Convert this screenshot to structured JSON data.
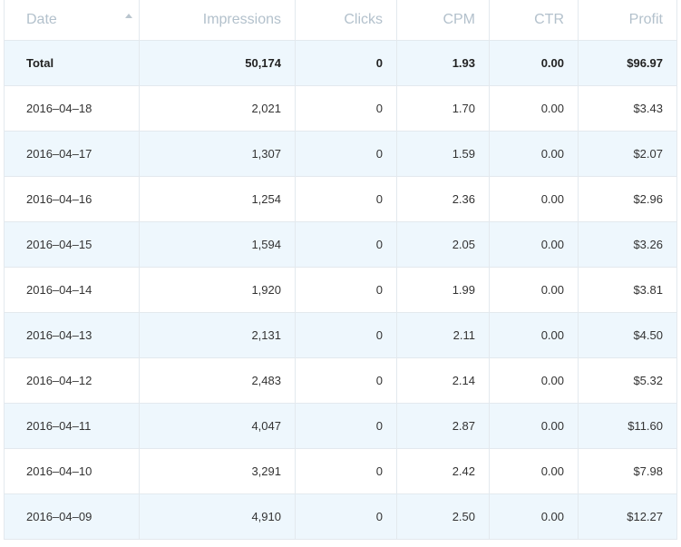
{
  "columns": {
    "date": "Date",
    "impressions": "Impressions",
    "clicks": "Clicks",
    "cpm": "CPM",
    "ctr": "CTR",
    "profit": "Profit"
  },
  "sort": {
    "column": "date",
    "icon": "sort-up-icon"
  },
  "total": {
    "label": "Total",
    "impressions": "50,174",
    "clicks": "0",
    "cpm": "1.93",
    "ctr": "0.00",
    "profit": "$96.97"
  },
  "rows": [
    {
      "date": "2016–04–18",
      "impressions": "2,021",
      "clicks": "0",
      "cpm": "1.70",
      "ctr": "0.00",
      "profit": "$3.43"
    },
    {
      "date": "2016–04–17",
      "impressions": "1,307",
      "clicks": "0",
      "cpm": "1.59",
      "ctr": "0.00",
      "profit": "$2.07"
    },
    {
      "date": "2016–04–16",
      "impressions": "1,254",
      "clicks": "0",
      "cpm": "2.36",
      "ctr": "0.00",
      "profit": "$2.96"
    },
    {
      "date": "2016–04–15",
      "impressions": "1,594",
      "clicks": "0",
      "cpm": "2.05",
      "ctr": "0.00",
      "profit": "$3.26"
    },
    {
      "date": "2016–04–14",
      "impressions": "1,920",
      "clicks": "0",
      "cpm": "1.99",
      "ctr": "0.00",
      "profit": "$3.81"
    },
    {
      "date": "2016–04–13",
      "impressions": "2,131",
      "clicks": "0",
      "cpm": "2.11",
      "ctr": "0.00",
      "profit": "$4.50"
    },
    {
      "date": "2016–04–12",
      "impressions": "2,483",
      "clicks": "0",
      "cpm": "2.14",
      "ctr": "0.00",
      "profit": "$5.32"
    },
    {
      "date": "2016–04–11",
      "impressions": "4,047",
      "clicks": "0",
      "cpm": "2.87",
      "ctr": "0.00",
      "profit": "$11.60"
    },
    {
      "date": "2016–04–10",
      "impressions": "3,291",
      "clicks": "0",
      "cpm": "2.42",
      "ctr": "0.00",
      "profit": "$7.98"
    },
    {
      "date": "2016–04–09",
      "impressions": "4,910",
      "clicks": "0",
      "cpm": "2.50",
      "ctr": "0.00",
      "profit": "$12.27"
    }
  ],
  "colors": {
    "header_text": "#b3c1cc",
    "row_alt_bg": "#eef7fd",
    "border": "#e3e9ee",
    "cell_text": "#333333"
  }
}
